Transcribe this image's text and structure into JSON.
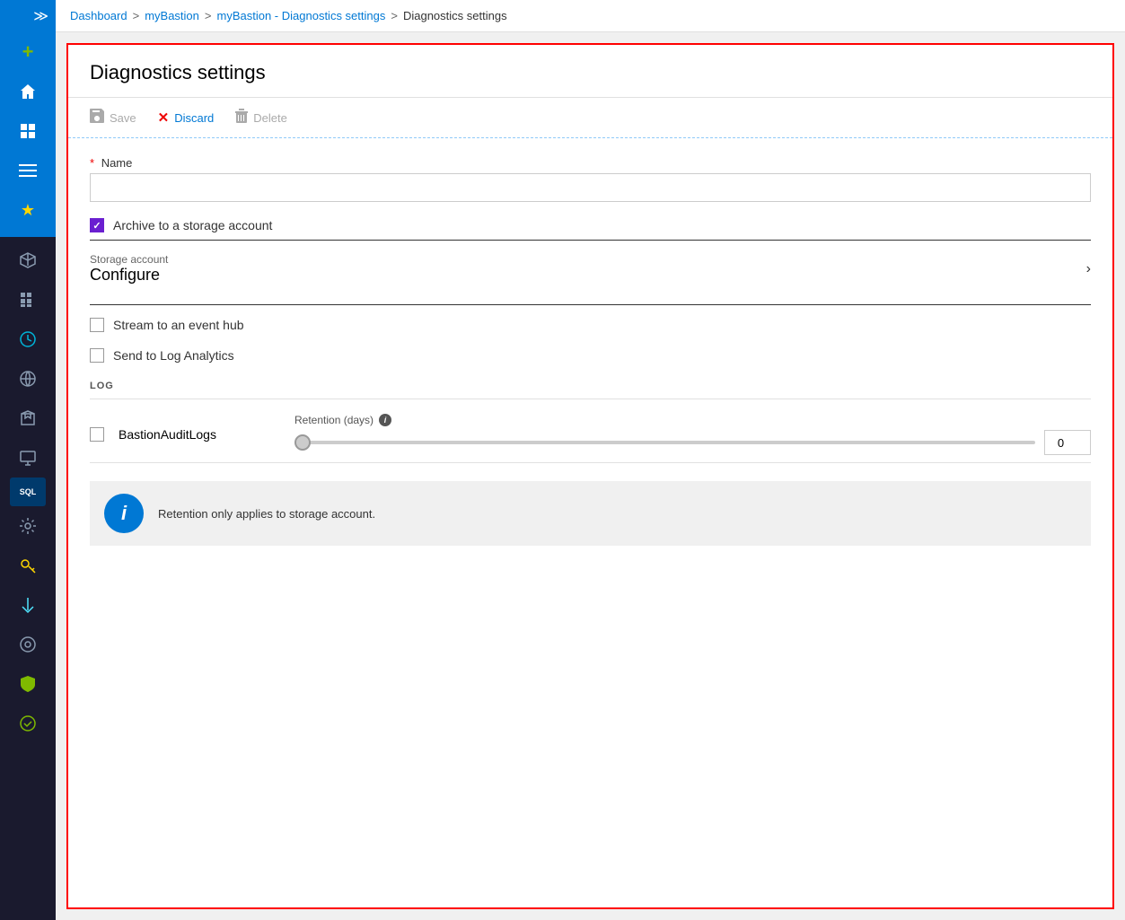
{
  "breadcrumb": {
    "items": [
      {
        "label": "Dashboard",
        "link": true
      },
      {
        "label": "myBastion",
        "link": true
      },
      {
        "label": "myBastion - Diagnostics settings",
        "link": true
      },
      {
        "label": "Diagnostics settings",
        "link": false
      }
    ]
  },
  "panel": {
    "title": "Diagnostics settings"
  },
  "toolbar": {
    "save_label": "Save",
    "discard_label": "Discard",
    "delete_label": "Delete"
  },
  "form": {
    "name_label": "Name",
    "name_placeholder": "",
    "archive_label": "Archive to a storage account",
    "archive_checked": true,
    "storage_account_label": "Storage account",
    "storage_configure_label": "Configure",
    "stream_event_hub_label": "Stream to an event hub",
    "stream_checked": false,
    "send_log_analytics_label": "Send to Log Analytics",
    "send_log_analytics_checked": false
  },
  "log_section": {
    "header": "LOG",
    "rows": [
      {
        "name": "BastionAuditLogs",
        "checked": false,
        "retention_label": "Retention (days)",
        "retention_value": "0"
      }
    ]
  },
  "info_banner": {
    "text": "Retention only applies to storage account."
  },
  "sidebar": {
    "icons": [
      {
        "name": "chevron",
        "symbol": "≫"
      },
      {
        "name": "plus",
        "symbol": "+"
      },
      {
        "name": "home",
        "symbol": "⌂"
      },
      {
        "name": "dashboard",
        "symbol": "▦"
      },
      {
        "name": "menu",
        "symbol": "≡"
      },
      {
        "name": "favorite",
        "symbol": "★"
      },
      {
        "name": "cube",
        "symbol": "⬡"
      },
      {
        "name": "grid",
        "symbol": "⊞"
      },
      {
        "name": "clock",
        "symbol": "◷"
      },
      {
        "name": "globe",
        "symbol": "🌐"
      },
      {
        "name": "box",
        "symbol": "📦"
      },
      {
        "name": "monitor",
        "symbol": "🖥"
      },
      {
        "name": "sql",
        "symbol": "SQL"
      },
      {
        "name": "settings",
        "symbol": "⚙"
      },
      {
        "name": "key",
        "symbol": "🔑"
      },
      {
        "name": "arrow-down",
        "symbol": "⬇"
      },
      {
        "name": "dial",
        "symbol": "◎"
      },
      {
        "name": "shield",
        "symbol": "🛡"
      }
    ]
  }
}
